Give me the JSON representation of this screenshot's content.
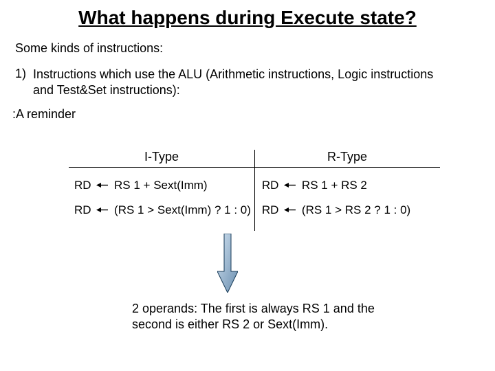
{
  "title": "What happens during Execute state?",
  "intro": "Some kinds of instructions:",
  "item1_num": "1)",
  "item1_text": "Instructions which use the ALU (Arithmetic instructions, Logic instructions and Test&Set instructions):",
  "reminder": ":A reminder",
  "table": {
    "head_left": "I-Type",
    "head_right": "R-Type",
    "rows": [
      {
        "l_pre": "RD",
        "l_post": "RS 1 + Sext(Imm)",
        "r_pre": "RD",
        "r_post": "RS 1 + RS 2"
      },
      {
        "l_pre": "RD",
        "l_post": "(RS 1 > Sext(Imm) ? 1 : 0)",
        "r_pre": "RD",
        "r_post": "(RS 1 > RS 2 ? 1 : 0)"
      }
    ]
  },
  "footnote": "2 operands: The first is always RS 1 and the second is either RS 2 or Sext(Imm)."
}
